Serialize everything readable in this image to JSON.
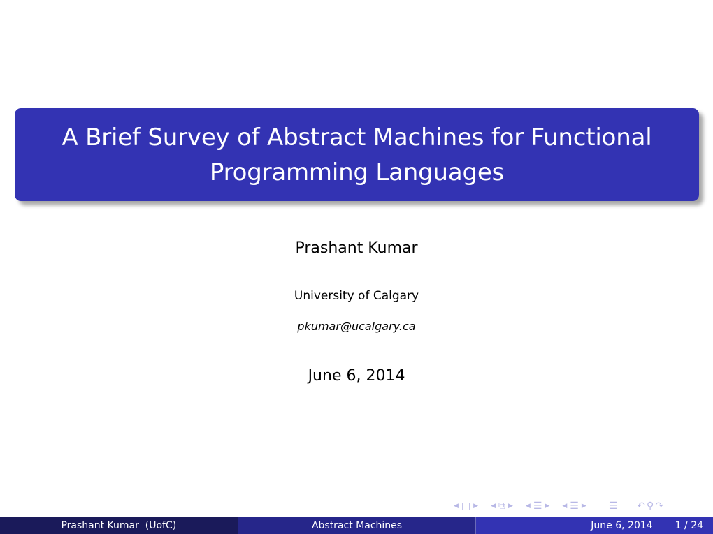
{
  "title": {
    "line1": "A Brief Survey of Abstract Machines for Functional",
    "line2": "Programming Languages"
  },
  "author": "Prashant Kumar",
  "institute": "University of Calgary",
  "email": "pkumar@ucalgary.ca",
  "date": "June 6, 2014",
  "navigation": {
    "icons": [
      "arrow-left",
      "frame",
      "arrow-right",
      "arrow-left",
      "subsection",
      "arrow-right",
      "arrow-left",
      "section",
      "arrow-right",
      "arrow-left",
      "section",
      "arrow-right",
      "align",
      "undo",
      "search",
      "redo"
    ],
    "glyphs": {
      "left": "◀",
      "right": "▶",
      "frame": "□",
      "subsection": "⧉",
      "section": "☰",
      "align": "☰",
      "undo": "↶",
      "search": "⚲",
      "redo": "↷"
    }
  },
  "footer": {
    "author_short": "Prashant Kumar  (UofC)",
    "short_title": "Abstract Machines",
    "date": "June 6, 2014",
    "page": "1 / 24"
  },
  "colors": {
    "title_bg": "#3333b3",
    "footer_left": "#1a1a5a",
    "footer_mid": "#26268a",
    "footer_right": "#3333b3",
    "nav_icons": "#b8b8e6"
  }
}
